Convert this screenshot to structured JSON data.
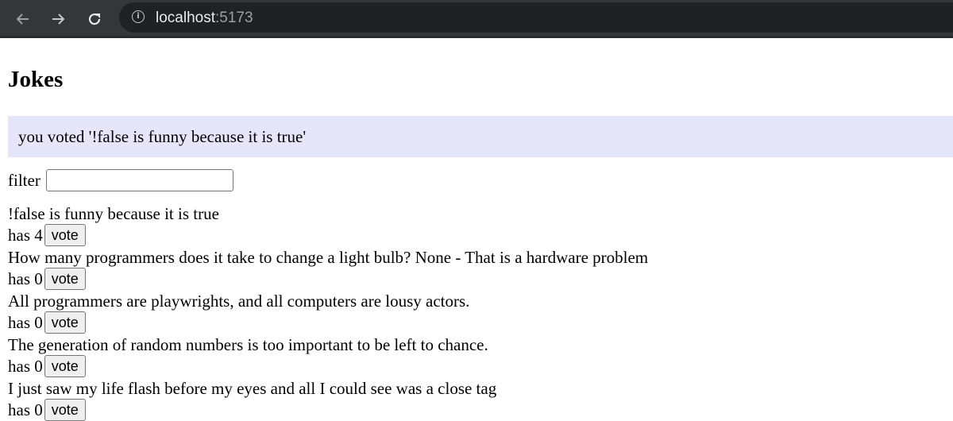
{
  "browser": {
    "url_host": "localhost",
    "url_port": ":5173",
    "icons": [
      "back-arrow-icon",
      "forward-arrow-icon",
      "reload-icon",
      "info-icon"
    ]
  },
  "page": {
    "title": "Jokes",
    "notification": "you voted '!false is funny because it is true'",
    "filter_label": "filter",
    "filter_value": "",
    "vote_label": "vote",
    "jokes": [
      {
        "text": "!false is funny because it is true",
        "votes": "has 4"
      },
      {
        "text": "How many programmers does it take to change a light bulb? None - That is a hardware problem",
        "votes": "has 0"
      },
      {
        "text": "All programmers are playwrights, and all computers are lousy actors.",
        "votes": "has 0"
      },
      {
        "text": "The generation of random numbers is too important to be left to chance.",
        "votes": "has 0"
      },
      {
        "text": "I just saw my life flash before my eyes and all I could see was a close tag",
        "votes": "has 0"
      }
    ]
  }
}
